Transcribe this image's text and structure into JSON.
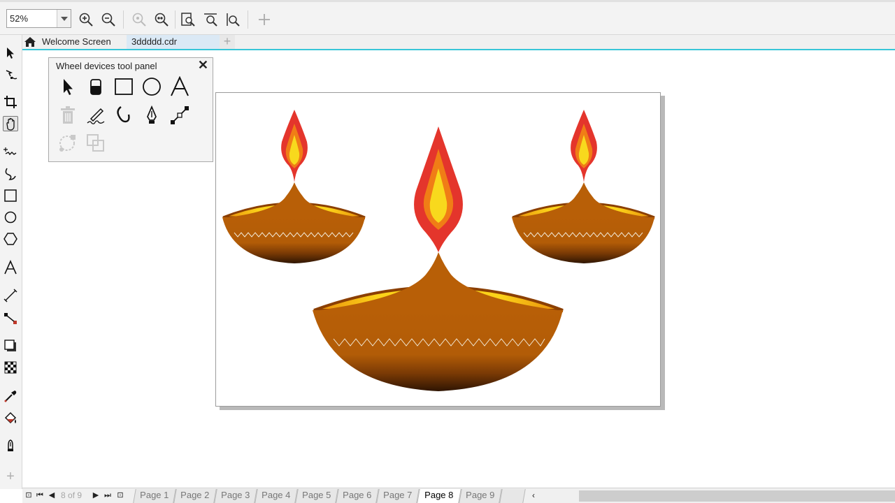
{
  "toolbar": {
    "zoom_value": "52%",
    "buttons": [
      "zoom-in-icon",
      "zoom-out-icon",
      "zoom-to-selected-icon",
      "zoom-to-all-objects-icon",
      "zoom-to-page-icon",
      "zoom-to-page-width-icon",
      "zoom-to-page-height-icon",
      "add-icon"
    ]
  },
  "tabs": {
    "welcome": "Welcome Screen",
    "document": "3ddddd.cdr",
    "add": "+"
  },
  "panel": {
    "title": "Wheel devices tool panel",
    "close": "✕"
  },
  "pagebar": {
    "current": "8",
    "of_label": "of",
    "total": "9",
    "pages": [
      "Page 1",
      "Page 2",
      "Page 3",
      "Page 4",
      "Page 5",
      "Page 6",
      "Page 7",
      "Page 8",
      "Page 9"
    ],
    "active_page": "Page 8"
  },
  "colors": {
    "accent": "#37c6d8",
    "lamp_body": "#b85f07",
    "lamp_rim": "#8b3f03",
    "flame_outer": "#e4352c",
    "flame_middle": "#f07d16",
    "flame_inner": "#f8d91d",
    "oil": "#f7c219"
  }
}
